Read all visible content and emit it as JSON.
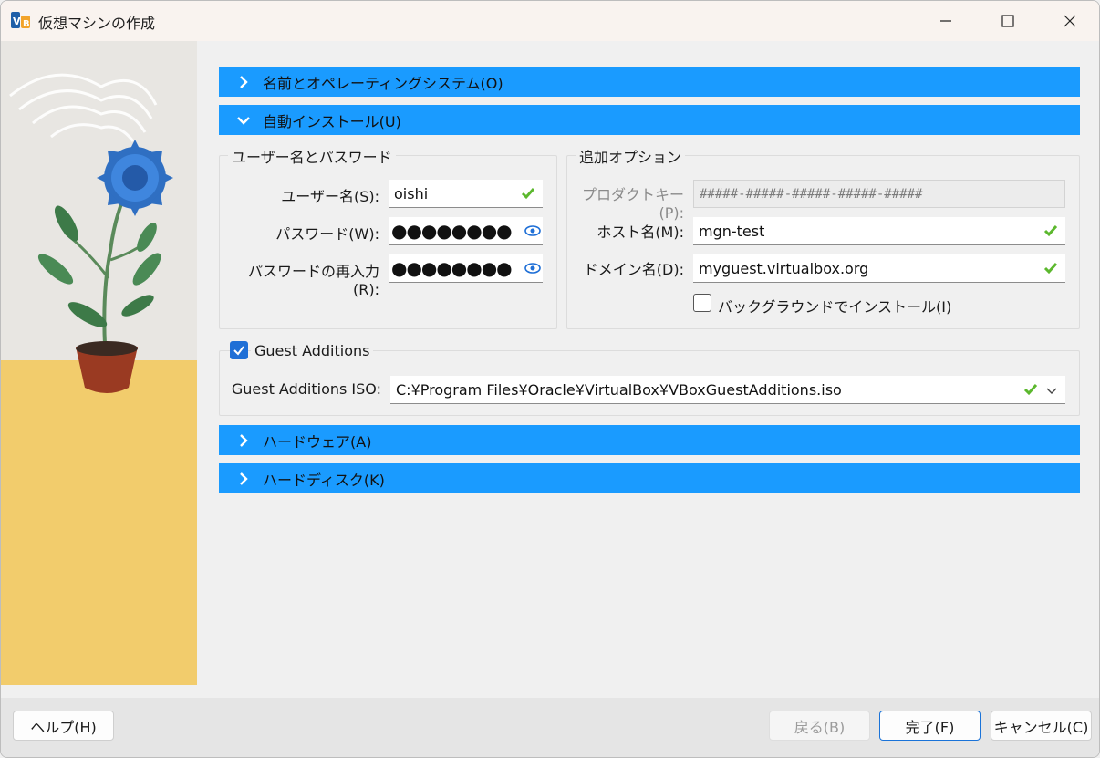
{
  "window": {
    "title": "仮想マシンの作成",
    "icons": [
      "virtualbox-app-icon",
      "minimize-icon",
      "maximize-icon",
      "close-icon"
    ]
  },
  "sections": {
    "name_os": "名前とオペレーティングシステム(O)",
    "unattended": "自動インストール(U)",
    "hardware": "ハードウェア(A)",
    "harddisk": "ハードディスク(K)"
  },
  "user_group": {
    "title": "ユーザー名とパスワード",
    "username_label": "ユーザー名(S):",
    "username_value": "oishi",
    "password_label": "パスワード(W):",
    "password_value": "●●●●●●●●",
    "repeat_label": "パスワードの再入力(R):",
    "repeat_value": "●●●●●●●●"
  },
  "options_group": {
    "title": "追加オプション",
    "product_key_label": "プロダクトキー(P):",
    "product_key_placeholder": "#####-#####-#####-#####-#####",
    "hostname_label": "ホスト名(M):",
    "hostname_value": "mgn-test",
    "domain_label": "ドメイン名(D):",
    "domain_value": "myguest.virtualbox.org",
    "background_install_label": "バックグラウンドでインストール(I)",
    "background_install_checked": false
  },
  "guest_additions": {
    "label": "Guest Additions",
    "checked": true,
    "iso_label": "Guest Additions ISO:",
    "iso_value": "C:¥Program Files¥Oracle¥VirtualBox¥VBoxGuestAdditions.iso"
  },
  "buttons": {
    "help": "ヘルプ(H)",
    "back": "戻る(B)",
    "finish": "完了(F)",
    "cancel": "キャンセル(C)"
  },
  "colors": {
    "section_header": "#1a9bff",
    "check_green": "#5cb82e",
    "checkbox_blue": "#1f6fd6",
    "side_yellow": "#f2cc6c"
  }
}
